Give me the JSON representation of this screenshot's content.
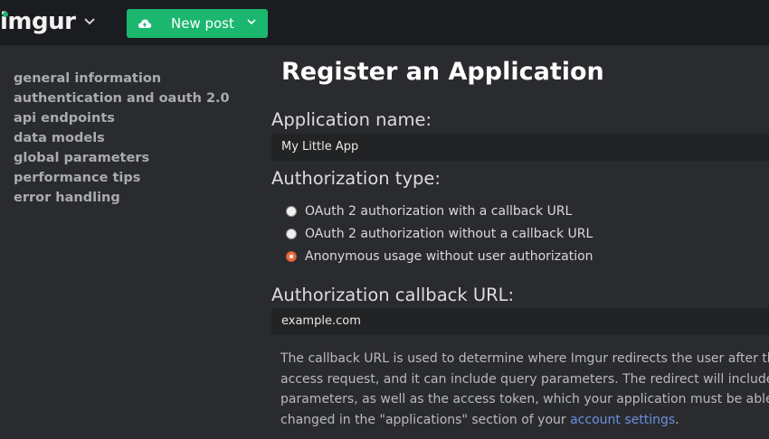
{
  "header": {
    "logo_text": "imgur",
    "new_post_label": "New post",
    "colors": {
      "brand_green": "#1bb76e",
      "header_bg": "#1b1c1f"
    },
    "icons": [
      "logo-chevron-icon",
      "cloud-upload-icon",
      "chevron-down-icon"
    ]
  },
  "sidebar": {
    "items": [
      {
        "label": "general information"
      },
      {
        "label": "authentication and oauth 2.0"
      },
      {
        "label": "api endpoints"
      },
      {
        "label": "data models"
      },
      {
        "label": "global parameters"
      },
      {
        "label": "performance tips"
      },
      {
        "label": "error handling"
      }
    ]
  },
  "form": {
    "title": "Register an Application",
    "app_name": {
      "label": "Application name:",
      "value": "My Little App"
    },
    "auth_type": {
      "label": "Authorization type:",
      "options": [
        {
          "label": "OAuth 2 authorization with a callback URL",
          "checked": false
        },
        {
          "label": "OAuth 2 authorization without a callback URL",
          "checked": false
        },
        {
          "label": "Anonymous usage without user authorization",
          "checked": true
        }
      ]
    },
    "callback": {
      "label": "Authorization callback URL:",
      "value": "example.com"
    },
    "help": {
      "line1": "The callback URL is used to determine where Imgur redirects the user after they",
      "line2": "access request, and it can include query parameters. The redirect will include the",
      "line3": "parameters, as well as the access token, which your application must be able to p",
      "line4_prefix": "changed in the \"applications\" section of your ",
      "line4_link": "account settings",
      "line4_suffix": "."
    },
    "colors": {
      "radio_selected": "#e96e44",
      "link": "#6b8fe0"
    }
  }
}
